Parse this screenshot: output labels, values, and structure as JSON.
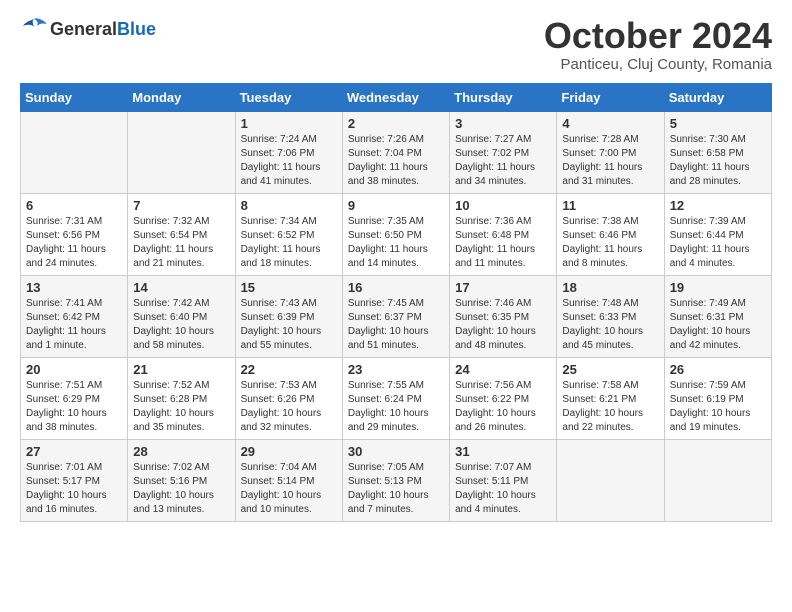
{
  "header": {
    "logo": {
      "general": "General",
      "blue": "Blue"
    },
    "title": "October 2024",
    "subtitle": "Panticeu, Cluj County, Romania"
  },
  "weekdays": [
    "Sunday",
    "Monday",
    "Tuesday",
    "Wednesday",
    "Thursday",
    "Friday",
    "Saturday"
  ],
  "weeks": [
    [
      {
        "day": "",
        "content": ""
      },
      {
        "day": "",
        "content": ""
      },
      {
        "day": "1",
        "content": "Sunrise: 7:24 AM\nSunset: 7:06 PM\nDaylight: 11 hours and 41 minutes."
      },
      {
        "day": "2",
        "content": "Sunrise: 7:26 AM\nSunset: 7:04 PM\nDaylight: 11 hours and 38 minutes."
      },
      {
        "day": "3",
        "content": "Sunrise: 7:27 AM\nSunset: 7:02 PM\nDaylight: 11 hours and 34 minutes."
      },
      {
        "day": "4",
        "content": "Sunrise: 7:28 AM\nSunset: 7:00 PM\nDaylight: 11 hours and 31 minutes."
      },
      {
        "day": "5",
        "content": "Sunrise: 7:30 AM\nSunset: 6:58 PM\nDaylight: 11 hours and 28 minutes."
      }
    ],
    [
      {
        "day": "6",
        "content": "Sunrise: 7:31 AM\nSunset: 6:56 PM\nDaylight: 11 hours and 24 minutes."
      },
      {
        "day": "7",
        "content": "Sunrise: 7:32 AM\nSunset: 6:54 PM\nDaylight: 11 hours and 21 minutes."
      },
      {
        "day": "8",
        "content": "Sunrise: 7:34 AM\nSunset: 6:52 PM\nDaylight: 11 hours and 18 minutes."
      },
      {
        "day": "9",
        "content": "Sunrise: 7:35 AM\nSunset: 6:50 PM\nDaylight: 11 hours and 14 minutes."
      },
      {
        "day": "10",
        "content": "Sunrise: 7:36 AM\nSunset: 6:48 PM\nDaylight: 11 hours and 11 minutes."
      },
      {
        "day": "11",
        "content": "Sunrise: 7:38 AM\nSunset: 6:46 PM\nDaylight: 11 hours and 8 minutes."
      },
      {
        "day": "12",
        "content": "Sunrise: 7:39 AM\nSunset: 6:44 PM\nDaylight: 11 hours and 4 minutes."
      }
    ],
    [
      {
        "day": "13",
        "content": "Sunrise: 7:41 AM\nSunset: 6:42 PM\nDaylight: 11 hours and 1 minute."
      },
      {
        "day": "14",
        "content": "Sunrise: 7:42 AM\nSunset: 6:40 PM\nDaylight: 10 hours and 58 minutes."
      },
      {
        "day": "15",
        "content": "Sunrise: 7:43 AM\nSunset: 6:39 PM\nDaylight: 10 hours and 55 minutes."
      },
      {
        "day": "16",
        "content": "Sunrise: 7:45 AM\nSunset: 6:37 PM\nDaylight: 10 hours and 51 minutes."
      },
      {
        "day": "17",
        "content": "Sunrise: 7:46 AM\nSunset: 6:35 PM\nDaylight: 10 hours and 48 minutes."
      },
      {
        "day": "18",
        "content": "Sunrise: 7:48 AM\nSunset: 6:33 PM\nDaylight: 10 hours and 45 minutes."
      },
      {
        "day": "19",
        "content": "Sunrise: 7:49 AM\nSunset: 6:31 PM\nDaylight: 10 hours and 42 minutes."
      }
    ],
    [
      {
        "day": "20",
        "content": "Sunrise: 7:51 AM\nSunset: 6:29 PM\nDaylight: 10 hours and 38 minutes."
      },
      {
        "day": "21",
        "content": "Sunrise: 7:52 AM\nSunset: 6:28 PM\nDaylight: 10 hours and 35 minutes."
      },
      {
        "day": "22",
        "content": "Sunrise: 7:53 AM\nSunset: 6:26 PM\nDaylight: 10 hours and 32 minutes."
      },
      {
        "day": "23",
        "content": "Sunrise: 7:55 AM\nSunset: 6:24 PM\nDaylight: 10 hours and 29 minutes."
      },
      {
        "day": "24",
        "content": "Sunrise: 7:56 AM\nSunset: 6:22 PM\nDaylight: 10 hours and 26 minutes."
      },
      {
        "day": "25",
        "content": "Sunrise: 7:58 AM\nSunset: 6:21 PM\nDaylight: 10 hours and 22 minutes."
      },
      {
        "day": "26",
        "content": "Sunrise: 7:59 AM\nSunset: 6:19 PM\nDaylight: 10 hours and 19 minutes."
      }
    ],
    [
      {
        "day": "27",
        "content": "Sunrise: 7:01 AM\nSunset: 5:17 PM\nDaylight: 10 hours and 16 minutes."
      },
      {
        "day": "28",
        "content": "Sunrise: 7:02 AM\nSunset: 5:16 PM\nDaylight: 10 hours and 13 minutes."
      },
      {
        "day": "29",
        "content": "Sunrise: 7:04 AM\nSunset: 5:14 PM\nDaylight: 10 hours and 10 minutes."
      },
      {
        "day": "30",
        "content": "Sunrise: 7:05 AM\nSunset: 5:13 PM\nDaylight: 10 hours and 7 minutes."
      },
      {
        "day": "31",
        "content": "Sunrise: 7:07 AM\nSunset: 5:11 PM\nDaylight: 10 hours and 4 minutes."
      },
      {
        "day": "",
        "content": ""
      },
      {
        "day": "",
        "content": ""
      }
    ]
  ]
}
